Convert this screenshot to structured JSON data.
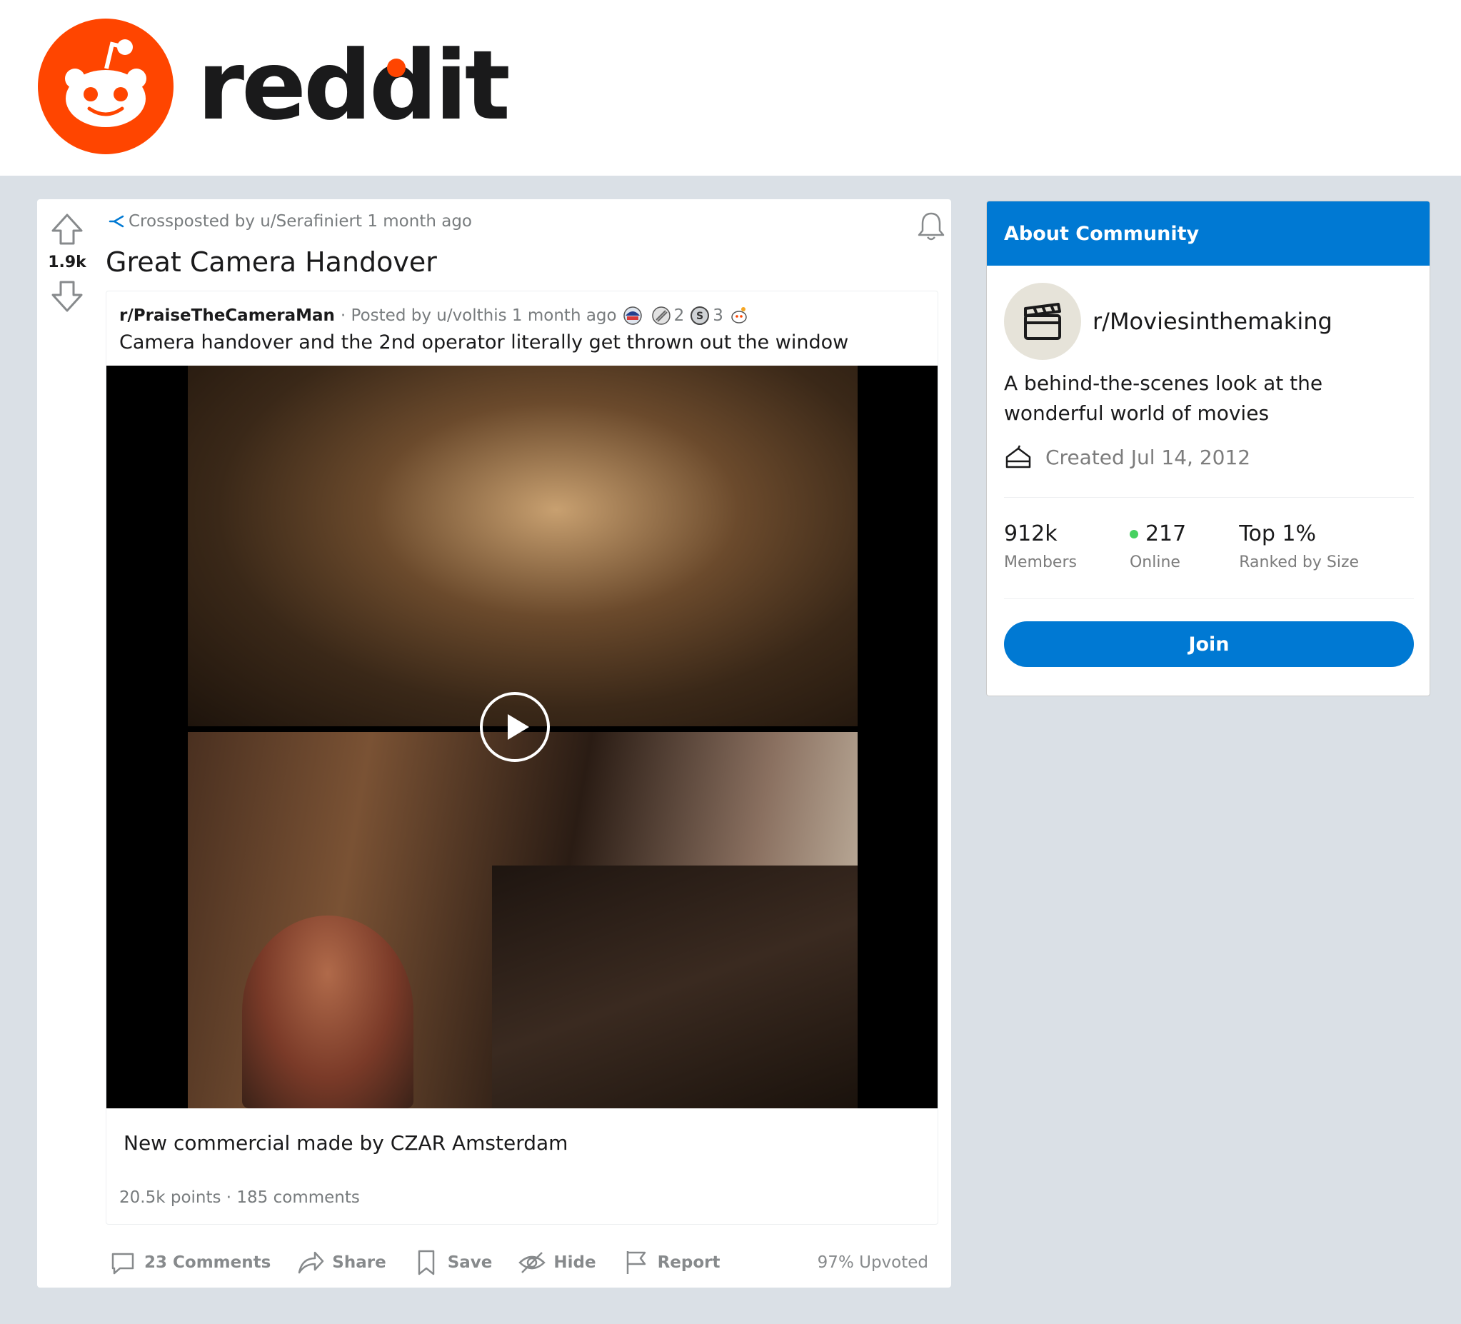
{
  "brand": {
    "wordmark": "reddit",
    "accent": "#ff4500"
  },
  "post": {
    "vote_count": "1.9k",
    "crosspost_line": "Crossposted by u/Serafiniert 1 month ago",
    "title": "Great Camera Handover",
    "original": {
      "subreddit": "r/PraiseTheCameraMan",
      "posted_by": "· Posted by u/volthis 1 month ago",
      "awards": [
        {
          "icon": "helmet-award-icon",
          "count": ""
        },
        {
          "icon": "bandage-award-icon",
          "count": "2"
        },
        {
          "icon": "silver-award-icon",
          "count": "3"
        },
        {
          "icon": "snoo-award-icon",
          "count": ""
        }
      ],
      "title": "Camera handover and the 2nd operator literally get thrown out the window",
      "body": "New commercial made by CZAR Amsterdam",
      "stats": "20.5k points · 185 comments"
    },
    "actions": {
      "comments": "23 Comments",
      "share": "Share",
      "save": "Save",
      "hide": "Hide",
      "report": "Report"
    },
    "upvoted": "97% Upvoted"
  },
  "sidebar": {
    "header": "About Community",
    "community_name": "r/Moviesinthemaking",
    "description": "A behind-the-scenes look at the wonderful world of movies",
    "created": "Created Jul 14, 2012",
    "stats": [
      {
        "value": "912k",
        "label": "Members"
      },
      {
        "value": "217",
        "label": "Online"
      },
      {
        "value": "Top 1%",
        "label": "Ranked by Size"
      }
    ],
    "join_label": "Join",
    "accent": "#0079d3"
  }
}
